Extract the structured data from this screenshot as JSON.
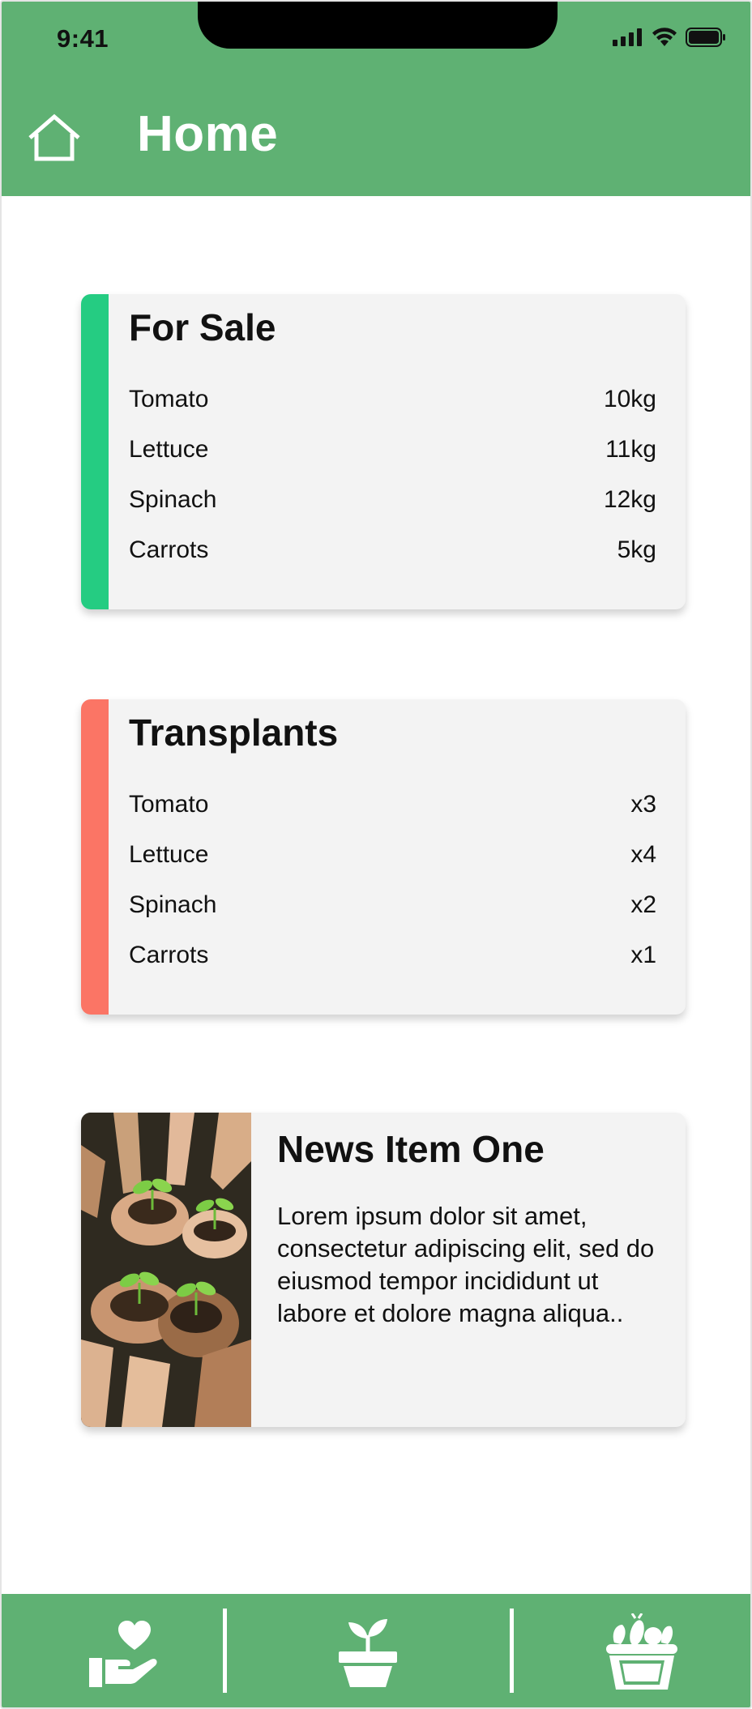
{
  "status_bar": {
    "time": "9:41"
  },
  "header": {
    "title": "Home",
    "icon": "home-icon"
  },
  "for_sale": {
    "title": "For Sale",
    "accent": "#25cc82",
    "items": [
      {
        "name": "Tomato",
        "value": "10kg"
      },
      {
        "name": "Lettuce",
        "value": "11kg"
      },
      {
        "name": "Spinach",
        "value": "12kg"
      },
      {
        "name": "Carrots",
        "value": "5kg"
      }
    ]
  },
  "transplants": {
    "title": "Transplants",
    "accent": "#fb7565",
    "items": [
      {
        "name": "Tomato",
        "value": "x3"
      },
      {
        "name": "Lettuce",
        "value": "x4"
      },
      {
        "name": "Spinach",
        "value": "x2"
      },
      {
        "name": "Carrots",
        "value": "x1"
      }
    ]
  },
  "news": {
    "title": "News Item One",
    "body": "Lorem ipsum dolor sit amet, consectetur adipiscing elit, sed do eiusmod tempor incididunt ut labore et dolore magna aliqua.."
  },
  "bottom_nav": {
    "items": [
      {
        "icon": "donate-hand-heart-icon"
      },
      {
        "icon": "plant-pot-icon"
      },
      {
        "icon": "produce-basket-icon"
      }
    ]
  },
  "colors": {
    "brand": "#5fb173",
    "sale": "#25cc82",
    "transplant": "#fb7565"
  }
}
